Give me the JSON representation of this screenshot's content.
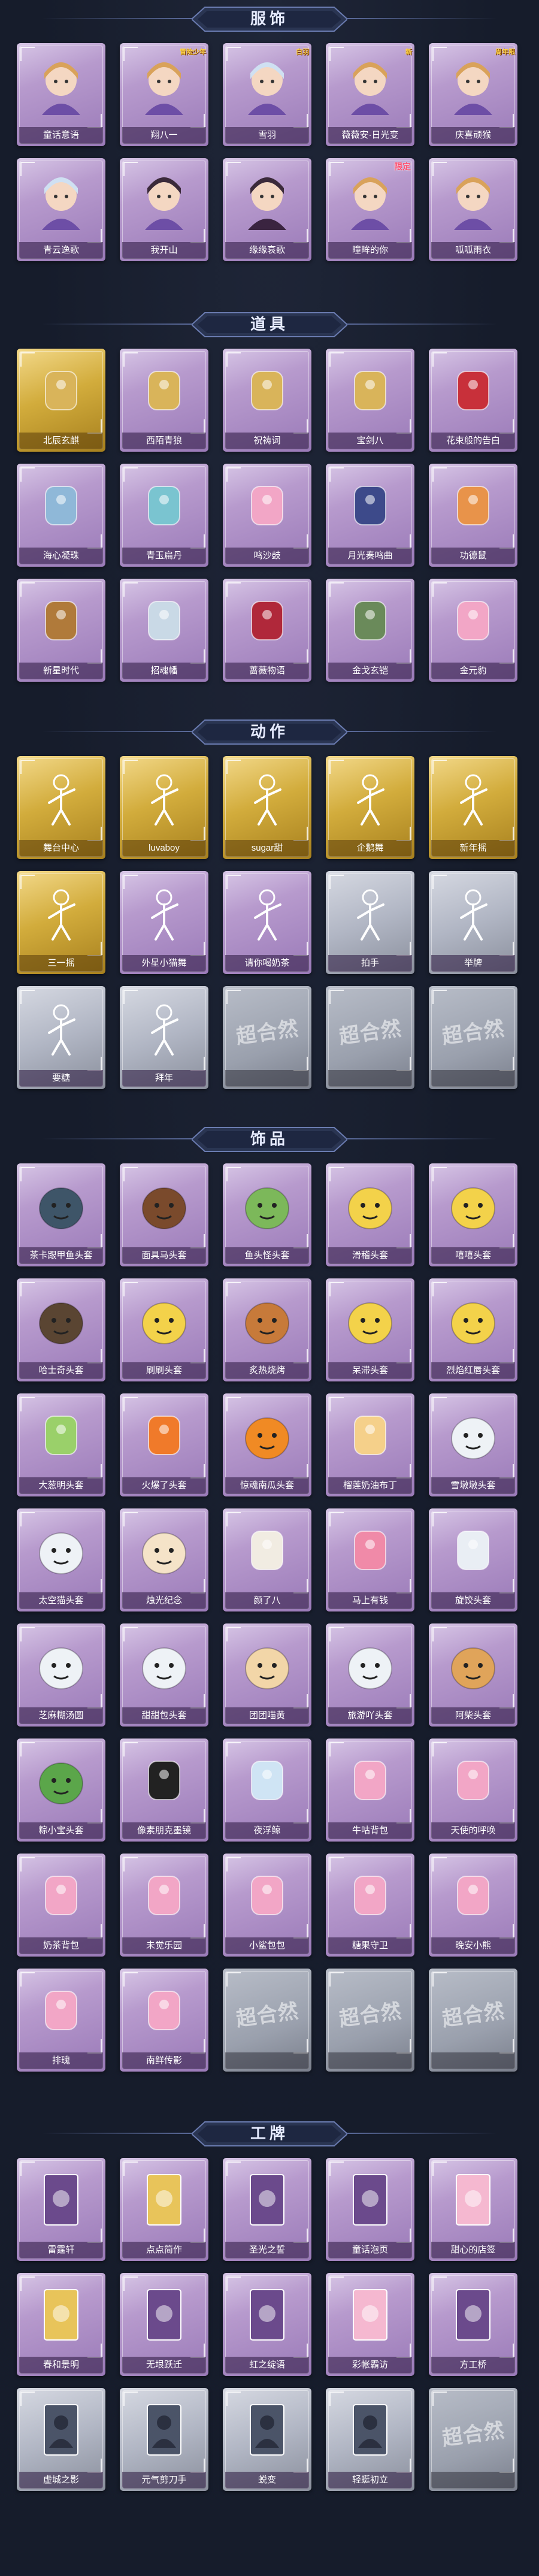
{
  "sections": {
    "costumes": {
      "title": "服饰",
      "items": [
        {
          "label": "童话意语",
          "icon": "doll-portrait-icon",
          "badge": ""
        },
        {
          "label": "翔八一",
          "icon": "boy-portrait-icon",
          "badge": "",
          "top_tag": "冒险少年"
        },
        {
          "label": "雪羽",
          "icon": "snow-girl-portrait-icon",
          "badge": "",
          "top_tag": "白羽"
        },
        {
          "label": "薇薇安·日光变",
          "icon": "girl-portrait-icon",
          "badge": "",
          "top_tag": "新"
        },
        {
          "label": "庆喜顽猴",
          "icon": "cake-girl-portrait-icon",
          "badge": "",
          "top_tag": "周年限"
        },
        {
          "label": "青云逸歌",
          "icon": "cyan-boy-portrait-icon",
          "badge": ""
        },
        {
          "label": "我开山",
          "icon": "dark-boy-portrait-icon",
          "badge": ""
        },
        {
          "label": "缘缘哀歌",
          "icon": "gothic-girl-portrait-icon",
          "badge": ""
        },
        {
          "label": "瞳眸的你",
          "icon": "hat-girl-portrait-icon",
          "badge": "",
          "limited": "限定"
        },
        {
          "label": "呱呱雨衣",
          "icon": "frog-girl-portrait-icon",
          "badge": ""
        }
      ]
    },
    "props": {
      "title": "道具",
      "items": [
        {
          "label": "北辰玄麒",
          "icon": "golden-dragon-icon",
          "badge": "",
          "style": "gold"
        },
        {
          "label": "西陌青狼",
          "icon": "bow-icon",
          "badge": ""
        },
        {
          "label": "祝祷词",
          "icon": "cross-staff-icon",
          "badge": ""
        },
        {
          "label": "宝剑八",
          "icon": "heart-wand-icon",
          "badge": ""
        },
        {
          "label": "花束般的告白",
          "icon": "rose-icon",
          "badge": ""
        },
        {
          "label": "海心凝珠",
          "icon": "shell-pearl-icon",
          "badge": ""
        },
        {
          "label": "青玉扁丹",
          "icon": "bottle-icon",
          "badge": ""
        },
        {
          "label": "鸣沙鼓",
          "icon": "dreamcatcher-icon",
          "badge": ""
        },
        {
          "label": "月光奏鸣曲",
          "icon": "piano-icon",
          "badge": ""
        },
        {
          "label": "功德鼠",
          "icon": "tiger-toy-icon",
          "badge": ""
        },
        {
          "label": "新星时代",
          "icon": "revolver-icon",
          "badge": ""
        },
        {
          "label": "招魂幡",
          "icon": "banner-icon",
          "badge": ""
        },
        {
          "label": "蔷薇物语",
          "icon": "medkit-icon",
          "badge": ""
        },
        {
          "label": "金戈玄铠",
          "icon": "lantern-icon",
          "badge": ""
        },
        {
          "label": "金元豹",
          "icon": "lucky-cat-icon",
          "badge": ""
        }
      ]
    },
    "actions": {
      "title": "动作",
      "items": [
        {
          "label": "舞台中心",
          "icon": "pose-figure-icon",
          "style": "gold"
        },
        {
          "label": "luvaboy",
          "icon": "pose-figure-icon",
          "style": "gold"
        },
        {
          "label": "sugar甜",
          "icon": "pose-figure-icon",
          "style": "gold"
        },
        {
          "label": "企鹅舞",
          "icon": "pose-figure-icon",
          "style": "gold"
        },
        {
          "label": "新年摇",
          "icon": "pose-figure-icon",
          "style": "gold"
        },
        {
          "label": "三一摇",
          "icon": "pose-figure-icon",
          "style": "gold"
        },
        {
          "label": "外星小猫舞",
          "icon": "pose-figure-icon",
          "style": "purple"
        },
        {
          "label": "请你喝奶茶",
          "icon": "pose-figure-icon",
          "style": "purple"
        },
        {
          "label": "拍手",
          "icon": "pose-figure-icon",
          "style": "silver"
        },
        {
          "label": "举牌",
          "icon": "pose-figure-icon",
          "style": "silver"
        },
        {
          "label": "要糖",
          "icon": "pose-figure-icon",
          "style": "silver"
        },
        {
          "label": "拜年",
          "icon": "pose-figure-icon",
          "style": "silver"
        },
        {
          "label": "",
          "icon": "placeholder",
          "style": "grey",
          "placeholder": "超合然"
        },
        {
          "label": "",
          "icon": "placeholder",
          "style": "grey",
          "placeholder": "超合然"
        },
        {
          "label": "",
          "icon": "placeholder",
          "style": "grey",
          "placeholder": "超合然"
        }
      ]
    },
    "accessories": {
      "title": "饰品",
      "items": [
        {
          "label": "茶卡跟甲鱼头套",
          "icon": "fish-head-icon"
        },
        {
          "label": "面具马头套",
          "icon": "horse-head-icon"
        },
        {
          "label": "鱼头怪头套",
          "icon": "fishman-head-icon"
        },
        {
          "label": "滑稽头套",
          "icon": "smile-face-icon"
        },
        {
          "label": "嘻嘻头套",
          "icon": "grin-face-icon"
        },
        {
          "label": "哈士奇头套",
          "icon": "husky-head-icon"
        },
        {
          "label": "刷刷头套",
          "icon": "blush-face-icon"
        },
        {
          "label": "炙热烧烤",
          "icon": "toast-face-icon"
        },
        {
          "label": "呆滞头套",
          "icon": "dull-face-icon"
        },
        {
          "label": "烈焰红唇头套",
          "icon": "pikachu-head-icon"
        },
        {
          "label": "大葱明头套",
          "icon": "radish-icon"
        },
        {
          "label": "火爆了头套",
          "icon": "fire-spirit-icon"
        },
        {
          "label": "惊魂南瓜头套",
          "icon": "pumpkin-icon"
        },
        {
          "label": "榴莲奶油布丁",
          "icon": "pudding-icon"
        },
        {
          "label": "雪墩墩头套",
          "icon": "snowman-icon"
        },
        {
          "label": "太空猫头套",
          "icon": "ghost-icon"
        },
        {
          "label": "烛光纪念",
          "icon": "candle-face-icon"
        },
        {
          "label": "颜了八",
          "icon": "garlic-icon"
        },
        {
          "label": "马上有钱",
          "icon": "piggy-icon"
        },
        {
          "label": "旋饺头套",
          "icon": "cloud-icon"
        },
        {
          "label": "芝麻糊汤圆",
          "icon": "dumpling-icon"
        },
        {
          "label": "甜甜包头套",
          "icon": "bun-icon"
        },
        {
          "label": "团团喵黄",
          "icon": "cat-bun-icon"
        },
        {
          "label": "旅游吖头套",
          "icon": "egg-hat-icon"
        },
        {
          "label": "阿柴头套",
          "icon": "shiba-head-icon"
        },
        {
          "label": "粽小宝头套",
          "icon": "zongzi-icon"
        },
        {
          "label": "像素朋克墨镜",
          "icon": "pixel-glasses-icon"
        },
        {
          "label": "夜浮鲸",
          "icon": "snowflake-icon"
        },
        {
          "label": "牛咕背包",
          "icon": "cake-bag-icon"
        },
        {
          "label": "天使的呼唤",
          "icon": "angel-doll-icon"
        },
        {
          "label": "奶茶背包",
          "icon": "milk-tea-bag-icon"
        },
        {
          "label": "未觉乐园",
          "icon": "idol-doll-icon"
        },
        {
          "label": "小鲨包包",
          "icon": "shark-bag-icon"
        },
        {
          "label": "糖果守卫",
          "icon": "candy-charm-icon"
        },
        {
          "label": "晚安小熊",
          "icon": "bear-charm-icon"
        },
        {
          "label": "排瑰",
          "icon": "fox-spirit-icon"
        },
        {
          "label": "南鲜传影",
          "icon": "fairy-doll-icon"
        },
        {
          "label": "",
          "icon": "placeholder",
          "style": "grey",
          "placeholder": "超合然"
        },
        {
          "label": "",
          "icon": "placeholder",
          "style": "grey",
          "placeholder": "超合然"
        },
        {
          "label": "",
          "icon": "placeholder",
          "style": "grey",
          "placeholder": "超合然"
        }
      ]
    },
    "cards": {
      "title": "工牌",
      "items": [
        {
          "label": "雷霆轩",
          "icon": "card-stage-icon"
        },
        {
          "label": "点点简作",
          "icon": "card-gold-icon"
        },
        {
          "label": "圣光之誓",
          "icon": "card-temple-icon"
        },
        {
          "label": "童话泡页",
          "icon": "card-book-icon"
        },
        {
          "label": "甜心的店签",
          "icon": "card-pink-icon"
        },
        {
          "label": "春和景明",
          "icon": "card-gold-icon"
        },
        {
          "label": "无垠跃迁",
          "icon": "card-space-icon"
        },
        {
          "label": "虹之绽语",
          "icon": "card-rainbow-icon"
        },
        {
          "label": "彩帐霸访",
          "icon": "card-candy-icon"
        },
        {
          "label": "方工桥",
          "icon": "card-dark-icon"
        },
        {
          "label": "虚城之影",
          "icon": "card-silhouette-icon",
          "style": "silver"
        },
        {
          "label": "元气剪刀手",
          "icon": "card-silhouette-icon",
          "style": "silver"
        },
        {
          "label": "蜕变",
          "icon": "card-silhouette-icon",
          "style": "silver"
        },
        {
          "label": "轻蜓初立",
          "icon": "card-silhouette-icon",
          "style": "silver"
        },
        {
          "label": "",
          "icon": "placeholder",
          "style": "grey",
          "placeholder": "超合然"
        }
      ]
    }
  },
  "colors": {
    "background": "#161c2b",
    "card_purple": "#b79acd",
    "card_gold": "#d2ac3c",
    "card_silver": "#b1b6c4",
    "card_grey": "#9aa0ad",
    "header_text": "#e6ebff"
  }
}
